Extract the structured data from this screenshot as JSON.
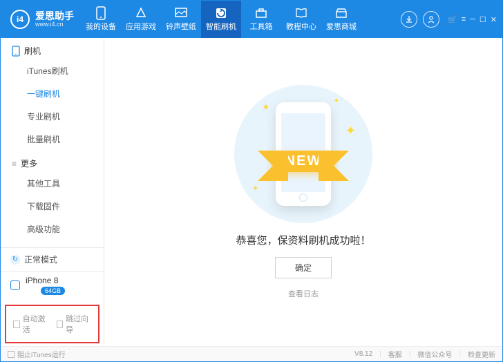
{
  "brand": {
    "name": "爱思助手",
    "url": "www.i4.cn",
    "badge": "i4"
  },
  "tabs": [
    {
      "label": "我的设备"
    },
    {
      "label": "应用游戏"
    },
    {
      "label": "铃声壁纸"
    },
    {
      "label": "智能刷机"
    },
    {
      "label": "工具箱"
    },
    {
      "label": "教程中心"
    },
    {
      "label": "爱思商城"
    }
  ],
  "sidebar": {
    "sections": [
      {
        "title": "刷机",
        "items": [
          "iTunes刷机",
          "一键刷机",
          "专业刷机",
          "批量刷机"
        ],
        "active": 1
      },
      {
        "title": "更多",
        "items": [
          "其他工具",
          "下载固件",
          "高级功能"
        ]
      }
    ]
  },
  "status": {
    "mode": "正常模式"
  },
  "device": {
    "name": "iPhone 8",
    "storage": "64GB"
  },
  "options": {
    "auto_activate": "自动激活",
    "skip_guide": "跳过向导"
  },
  "main": {
    "ribbon": "NEW",
    "message": "恭喜您，保资料刷机成功啦！",
    "ok": "确定",
    "log": "查看日志"
  },
  "footer": {
    "block_itunes": "阻止iTunes运行",
    "version": "V8.12",
    "support": "客服",
    "wechat": "微信公众号",
    "update": "检查更新"
  }
}
